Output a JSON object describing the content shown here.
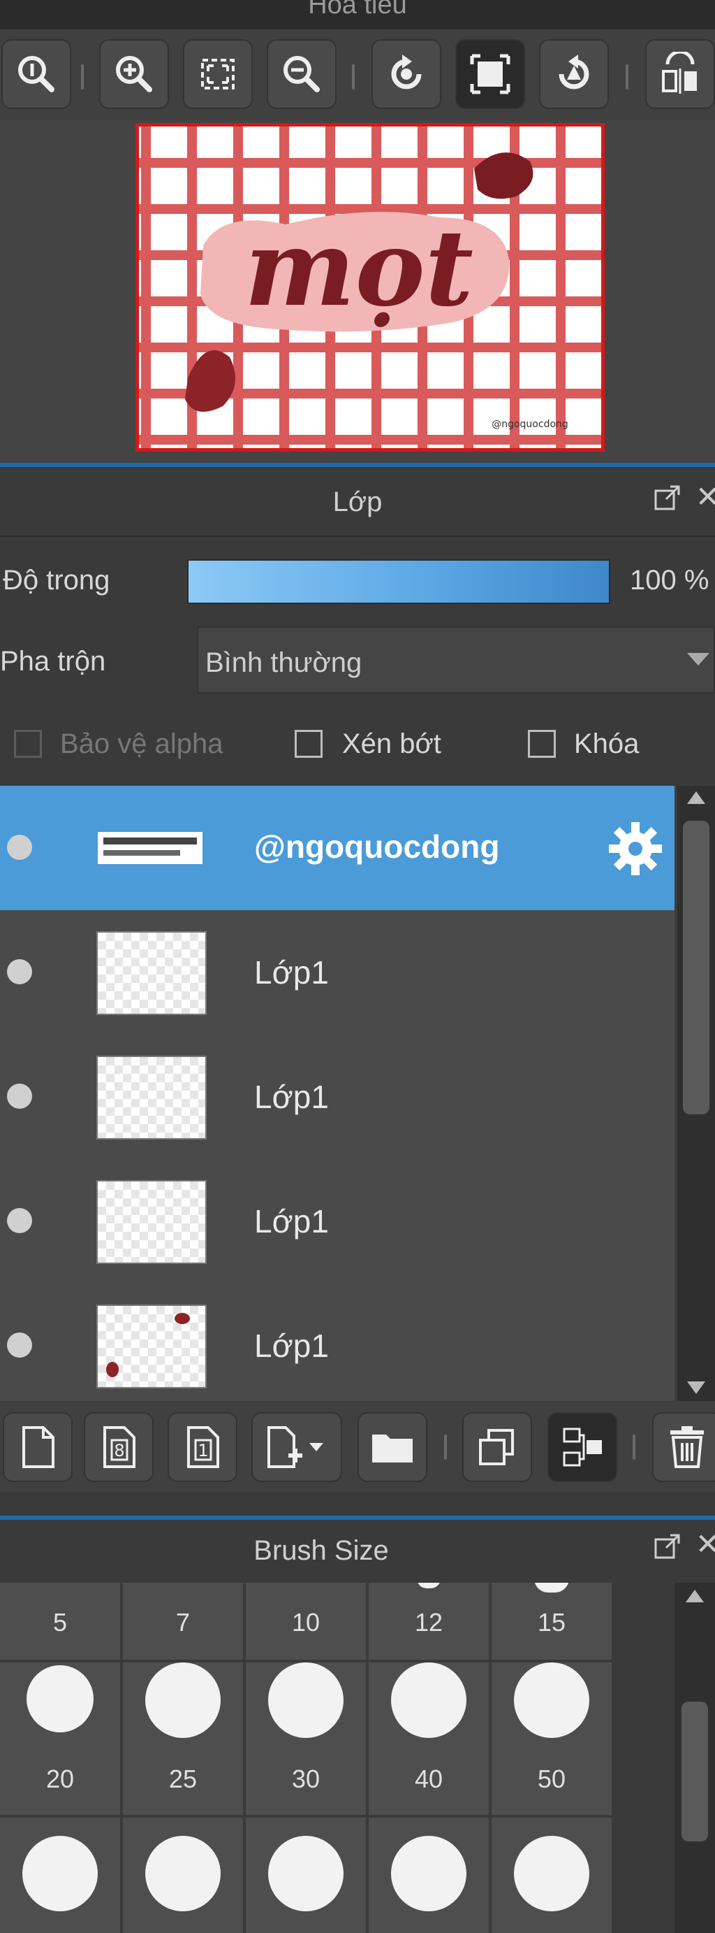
{
  "navigator": {
    "title": "Hoa tiêu"
  },
  "canvas_preview": {
    "lettering": "mọt",
    "watermark": "@ngoquocdong"
  },
  "layer_panel": {
    "title": "Lớp",
    "opacity_label": "Độ trong",
    "opacity_value": "100 %",
    "opacity_fraction": 1.0,
    "blend_label": "Pha trộn",
    "blend_value": "Bình thường",
    "protect_alpha_label": "Bảo vệ alpha",
    "clipping_label": "Xén bớt",
    "lock_label": "Khóa",
    "layers": [
      {
        "name": "@ngoquocdong",
        "selected": true
      },
      {
        "name": "Lớp1",
        "selected": false
      },
      {
        "name": "Lớp1",
        "selected": false
      },
      {
        "name": "Lớp1",
        "selected": false
      },
      {
        "name": "Lớp1",
        "selected": false
      }
    ]
  },
  "brush_panel": {
    "title": "Brush Size",
    "sizes_row1": [
      "5",
      "7",
      "10",
      "12",
      "15"
    ],
    "sizes_row2": [
      "20",
      "25",
      "30",
      "40",
      "50"
    ]
  },
  "colors": {
    "accent": "#4b9bd8",
    "canvas_grid": "#d95a5a",
    "lettering": "#7a1d22",
    "preview_border": "#d41818"
  }
}
